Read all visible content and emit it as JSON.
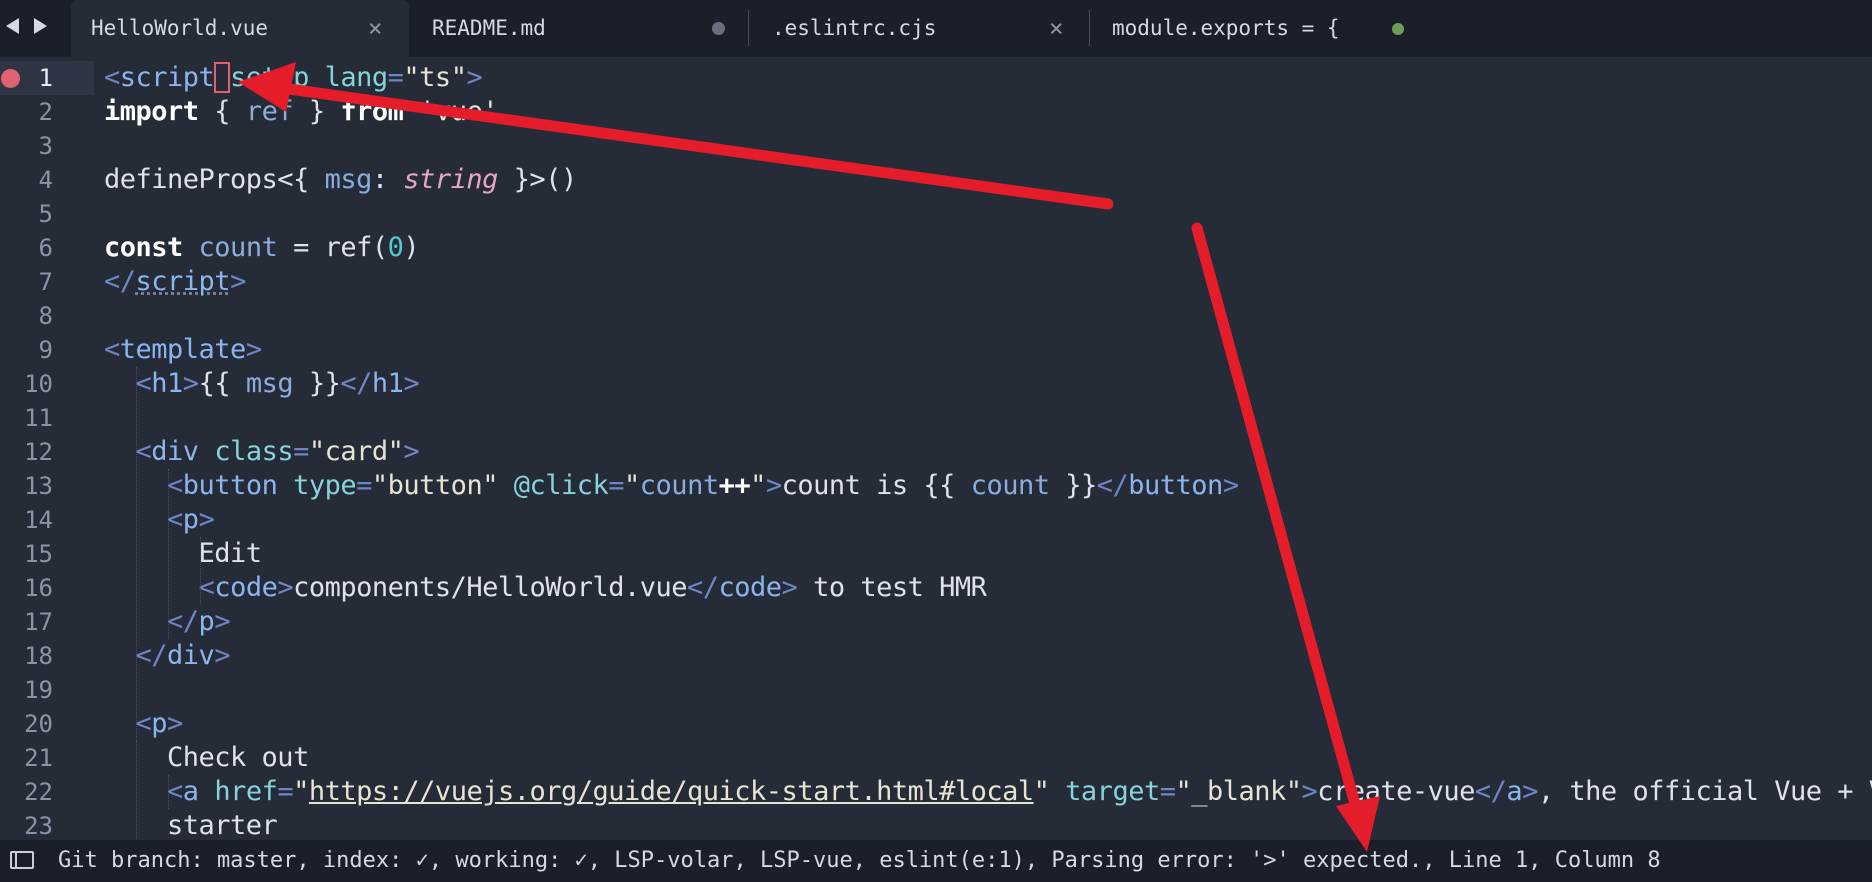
{
  "tabs": [
    {
      "label": "HelloWorld.vue",
      "state": "close"
    },
    {
      "label": "README.md",
      "state": "modified"
    },
    {
      "label": ".eslintrc.cjs",
      "state": "close"
    },
    {
      "label": "module.exports = {",
      "state": "saved"
    }
  ],
  "tab_close_glyph": "×",
  "colors": {
    "modified_dot": "#6a7080",
    "saved_dot": "#6b9e5a",
    "breakpoint": "#e0616f",
    "annotation_arrow": "#e51d2b"
  },
  "editor": {
    "lines": [
      {
        "n": "1",
        "tokens": [
          [
            "p",
            "<"
          ],
          [
            "g",
            "script"
          ],
          [
            "cur",
            " "
          ],
          [
            "a",
            "setup"
          ],
          [
            "w",
            " "
          ],
          [
            "a",
            "lang"
          ],
          [
            "p",
            "="
          ],
          [
            "s",
            "\"ts\""
          ],
          [
            "p",
            ">"
          ]
        ]
      },
      {
        "n": "2",
        "tokens": [
          [
            "k",
            "import"
          ],
          [
            "w",
            " { "
          ],
          [
            "v",
            "ref"
          ],
          [
            "w",
            " } "
          ],
          [
            "k",
            "from"
          ],
          [
            "w",
            " "
          ],
          [
            "s",
            "'vue'"
          ]
        ]
      },
      {
        "n": "3",
        "tokens": []
      },
      {
        "n": "4",
        "tokens": [
          [
            "w",
            "defineProps<{ "
          ],
          [
            "v",
            "msg"
          ],
          [
            "w",
            ": "
          ],
          [
            "i",
            "string"
          ],
          [
            "w",
            " }>()"
          ]
        ]
      },
      {
        "n": "5",
        "tokens": []
      },
      {
        "n": "6",
        "tokens": [
          [
            "k",
            "const"
          ],
          [
            "w",
            " "
          ],
          [
            "v",
            "count"
          ],
          [
            "w",
            " = ref("
          ],
          [
            "n",
            "0"
          ],
          [
            "w",
            ")"
          ]
        ]
      },
      {
        "n": "7",
        "tokens": [
          [
            "p",
            "</"
          ],
          [
            "gu",
            "script"
          ],
          [
            "p",
            ">"
          ]
        ]
      },
      {
        "n": "8",
        "tokens": []
      },
      {
        "n": "9",
        "tokens": [
          [
            "p",
            "<"
          ],
          [
            "g",
            "template"
          ],
          [
            "p",
            ">"
          ]
        ]
      },
      {
        "n": "10",
        "tokens": [
          [
            "w",
            "  "
          ],
          [
            "p",
            "<"
          ],
          [
            "g",
            "h1"
          ],
          [
            "p",
            ">"
          ],
          [
            "w",
            "{{ "
          ],
          [
            "v",
            "msg"
          ],
          [
            "w",
            " }}"
          ],
          [
            "p",
            "</"
          ],
          [
            "g",
            "h1"
          ],
          [
            "p",
            ">"
          ]
        ]
      },
      {
        "n": "11",
        "tokens": []
      },
      {
        "n": "12",
        "tokens": [
          [
            "w",
            "  "
          ],
          [
            "p",
            "<"
          ],
          [
            "g",
            "div"
          ],
          [
            "w",
            " "
          ],
          [
            "a",
            "class"
          ],
          [
            "p",
            "="
          ],
          [
            "s",
            "\"card\""
          ],
          [
            "p",
            ">"
          ]
        ]
      },
      {
        "n": "13",
        "tokens": [
          [
            "w",
            "    "
          ],
          [
            "p",
            "<"
          ],
          [
            "g",
            "button"
          ],
          [
            "w",
            " "
          ],
          [
            "a",
            "type"
          ],
          [
            "p",
            "="
          ],
          [
            "s",
            "\"button\""
          ],
          [
            "w",
            " "
          ],
          [
            "a",
            "@click"
          ],
          [
            "p",
            "="
          ],
          [
            "s",
            "\""
          ],
          [
            "v",
            "count"
          ],
          [
            "k",
            "++"
          ],
          [
            "s",
            "\""
          ],
          [
            "p",
            ">"
          ],
          [
            "w",
            "count is {{ "
          ],
          [
            "v",
            "count"
          ],
          [
            "w",
            " }}"
          ],
          [
            "p",
            "</"
          ],
          [
            "g",
            "button"
          ],
          [
            "p",
            ">"
          ]
        ]
      },
      {
        "n": "14",
        "tokens": [
          [
            "w",
            "    "
          ],
          [
            "p",
            "<"
          ],
          [
            "g",
            "p"
          ],
          [
            "p",
            ">"
          ]
        ]
      },
      {
        "n": "15",
        "tokens": [
          [
            "w",
            "      Edit"
          ]
        ]
      },
      {
        "n": "16",
        "tokens": [
          [
            "w",
            "      "
          ],
          [
            "p",
            "<"
          ],
          [
            "g",
            "code"
          ],
          [
            "p",
            ">"
          ],
          [
            "w",
            "components/HelloWorld.vue"
          ],
          [
            "p",
            "</"
          ],
          [
            "g",
            "code"
          ],
          [
            "p",
            ">"
          ],
          [
            "w",
            " to test HMR"
          ]
        ]
      },
      {
        "n": "17",
        "tokens": [
          [
            "w",
            "    "
          ],
          [
            "p",
            "</"
          ],
          [
            "g",
            "p"
          ],
          [
            "p",
            ">"
          ]
        ]
      },
      {
        "n": "18",
        "tokens": [
          [
            "w",
            "  "
          ],
          [
            "p",
            "</"
          ],
          [
            "g",
            "div"
          ],
          [
            "p",
            ">"
          ]
        ]
      },
      {
        "n": "19",
        "tokens": []
      },
      {
        "n": "20",
        "tokens": [
          [
            "w",
            "  "
          ],
          [
            "p",
            "<"
          ],
          [
            "g",
            "p"
          ],
          [
            "p",
            ">"
          ]
        ]
      },
      {
        "n": "21",
        "tokens": [
          [
            "w",
            "    Check out"
          ]
        ]
      },
      {
        "n": "22",
        "tokens": [
          [
            "w",
            "    "
          ],
          [
            "p",
            "<"
          ],
          [
            "g",
            "a"
          ],
          [
            "w",
            " "
          ],
          [
            "a",
            "href"
          ],
          [
            "p",
            "="
          ],
          [
            "s",
            "\""
          ],
          [
            "u",
            "https://vuejs.org/guide/quick-start.html#local"
          ],
          [
            "s",
            "\""
          ],
          [
            "w",
            " "
          ],
          [
            "a",
            "target"
          ],
          [
            "p",
            "="
          ],
          [
            "s",
            "\"_blank\""
          ],
          [
            "p",
            ">"
          ],
          [
            "w",
            "create-vue"
          ],
          [
            "p",
            "</"
          ],
          [
            "g",
            "a"
          ],
          [
            "p",
            ">"
          ],
          [
            "w",
            ", the official Vue + Vite"
          ]
        ]
      },
      {
        "n": "23",
        "tokens": [
          [
            "w",
            "    starter"
          ]
        ]
      }
    ]
  },
  "statusbar": {
    "text": "Git branch: master, index: ✓, working: ✓, LSP-volar, LSP-vue, eslint(e:1), Parsing error: '>' expected., Line 1, Column 8"
  }
}
